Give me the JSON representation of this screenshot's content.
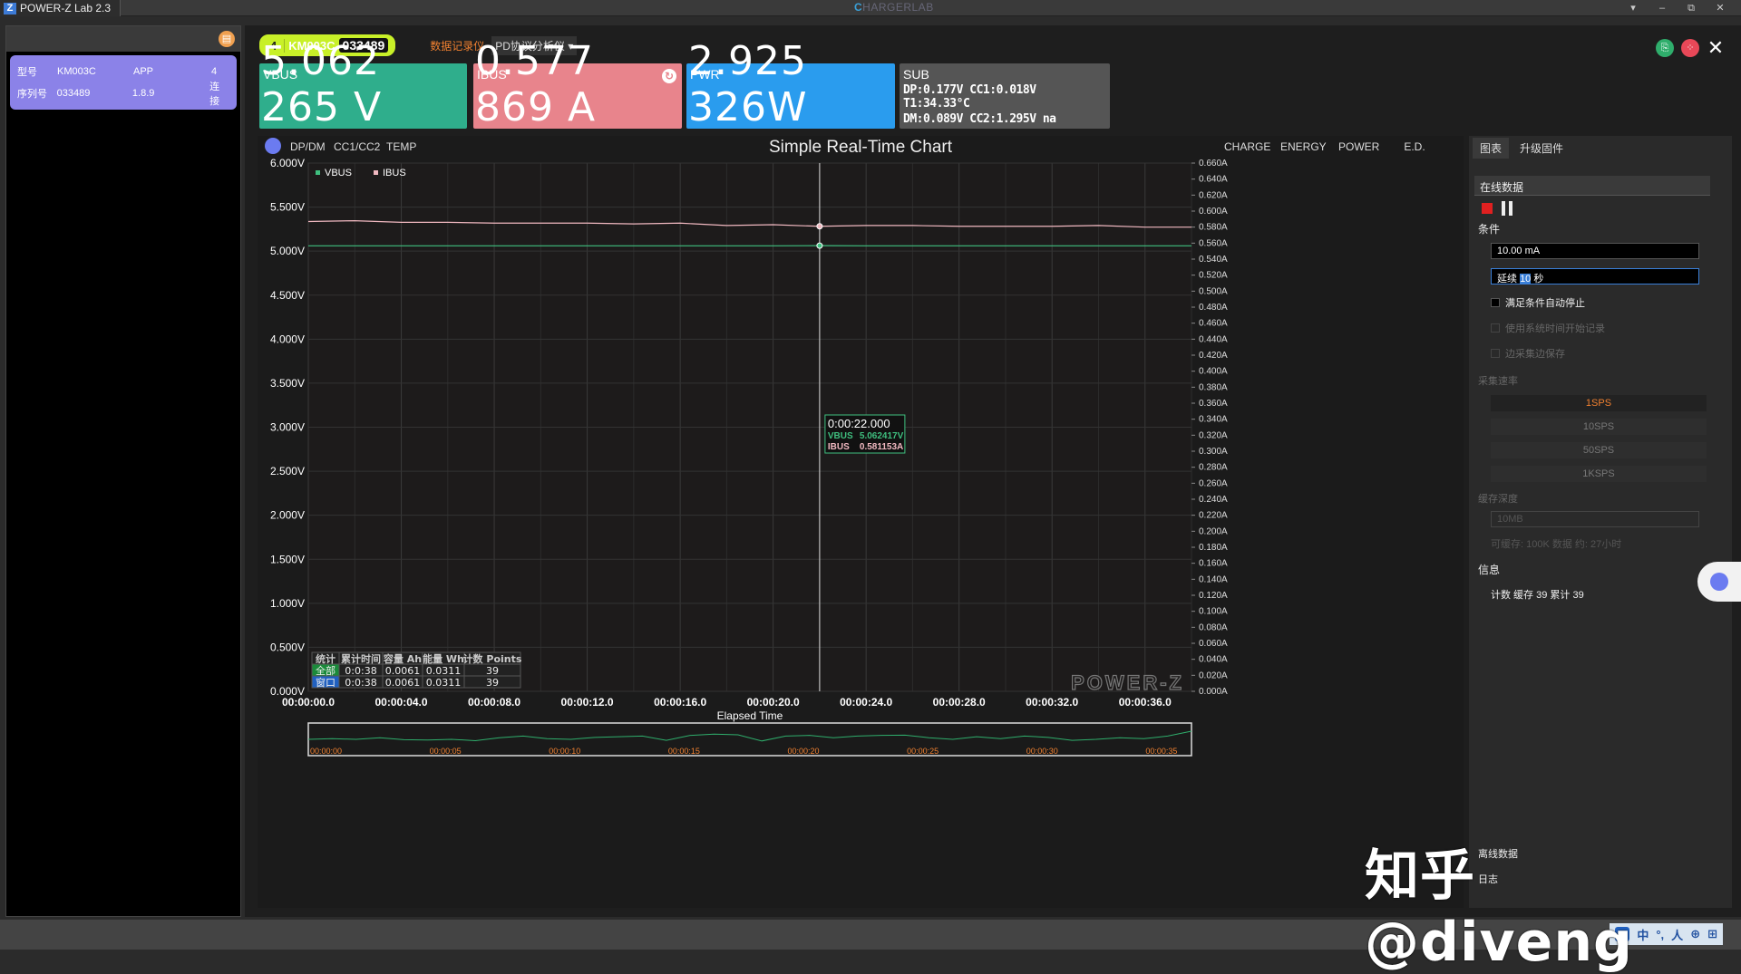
{
  "app": {
    "title": "POWER-Z Lab 2.3",
    "brand_prefix": "C",
    "brand_suffix": "HARGERLAB",
    "logo_glyph": "Z"
  },
  "window_controls": [
    "▾",
    "–",
    "⧉",
    "✕"
  ],
  "left_panel": {
    "device": {
      "row1": {
        "label": "型号",
        "value": "KM003C",
        "key": "APP",
        "num": "4"
      },
      "row2": {
        "label": "序列号",
        "value": "033489",
        "key": "1.8.9",
        "status": "连接"
      }
    }
  },
  "toolbar": {
    "device_num": "4",
    "device_model": "KM003C",
    "device_serial": "033489",
    "recorder_label": "数据记录仪",
    "pd_label": "PD协议分析仪",
    "close_glyph": "✕"
  },
  "tiles": {
    "vbus": {
      "label": "VBUS",
      "value": "5.062 265 V"
    },
    "ibus": {
      "label": "IBUS",
      "value": "0.577 869 A"
    },
    "pwr": {
      "label": "PWR",
      "value": "2.925 326W"
    },
    "sub": {
      "label": "SUB",
      "line1": "DP:0.177V   CC1:0.018V  T1:34.33°C",
      "line2": "DM:0.089V   CC2:1.295V  na"
    }
  },
  "chart_buttons": {
    "left": [
      "DP/DM",
      "CC1/CC2",
      "TEMP"
    ],
    "right": [
      "CHARGE",
      "ENERGY",
      "POWER",
      "E.D."
    ]
  },
  "chart_data": {
    "type": "line",
    "title": "Simple Real-Time Chart",
    "xlabel": "Elapsed Time",
    "ylabel_left": "",
    "ylabel_right": "",
    "x_ticks": [
      "00:00:00.0",
      "00:00:04.0",
      "00:00:08.0",
      "00:00:12.0",
      "00:00:16.0",
      "00:00:20.0",
      "00:00:24.0",
      "00:00:28.0",
      "00:00:32.0",
      "00:00:36.0"
    ],
    "y_left_ticks": [
      "6.000V",
      "5.500V",
      "5.000V",
      "4.500V",
      "4.000V",
      "3.500V",
      "3.000V",
      "2.500V",
      "2.000V",
      "1.500V",
      "1.000V",
      "0.500V",
      "0.000V"
    ],
    "y_right_ticks": [
      "0.660A",
      "0.640A",
      "0.620A",
      "0.600A",
      "0.580A",
      "0.560A",
      "0.540A",
      "0.520A",
      "0.500A",
      "0.480A",
      "0.460A",
      "0.440A",
      "0.420A",
      "0.400A",
      "0.380A",
      "0.360A",
      "0.340A",
      "0.320A",
      "0.300A",
      "0.280A",
      "0.260A",
      "0.240A",
      "0.220A",
      "0.200A",
      "0.180A",
      "0.160A",
      "0.140A",
      "0.120A",
      "0.100A",
      "0.080A",
      "0.060A",
      "0.040A",
      "0.020A",
      "0.000A"
    ],
    "xlim_seconds": [
      0,
      38
    ],
    "ylim_left": [
      0,
      6
    ],
    "ylim_right": [
      0,
      0.66
    ],
    "legend": [
      "VBUS",
      "IBUS"
    ],
    "legend_position": "top-left",
    "grid": true,
    "series": [
      {
        "name": "VBUS",
        "axis": "left",
        "color": "#3fbf7f",
        "x": [
          0,
          2,
          4,
          6,
          8,
          10,
          12,
          14,
          16,
          18,
          20,
          22,
          24,
          26,
          28,
          30,
          32,
          34,
          36,
          38
        ],
        "values": [
          5.06,
          5.06,
          5.06,
          5.06,
          5.06,
          5.06,
          5.06,
          5.06,
          5.06,
          5.06,
          5.06,
          5.062,
          5.06,
          5.06,
          5.06,
          5.06,
          5.06,
          5.06,
          5.06,
          5.06
        ]
      },
      {
        "name": "IBUS",
        "axis": "right",
        "color": "#f0b8c0",
        "x": [
          0,
          2,
          4,
          6,
          8,
          10,
          12,
          14,
          16,
          18,
          20,
          22,
          24,
          26,
          28,
          30,
          32,
          34,
          36,
          38
        ],
        "values": [
          0.587,
          0.588,
          0.586,
          0.586,
          0.585,
          0.585,
          0.585,
          0.584,
          0.585,
          0.582,
          0.583,
          0.581,
          0.582,
          0.582,
          0.581,
          0.581,
          0.581,
          0.582,
          0.58,
          0.58
        ]
      }
    ],
    "cursor": {
      "time": "0:00:22.000",
      "vbus": "5.062417V",
      "ibus": "0.581153A",
      "vbus_label": "VBUS",
      "ibus_label": "IBUS",
      "x_seconds": 22
    }
  },
  "stats": {
    "headers": [
      "统计",
      "累计时间",
      "容量 Ah",
      "能量 Wh",
      "计数 Points"
    ],
    "rows": [
      [
        "全部",
        "0:0:38",
        "0.0061",
        "0.0311",
        "39"
      ],
      [
        "窗口",
        "0:0:38",
        "0.0061",
        "0.0311",
        "39"
      ]
    ]
  },
  "chart_logo": "POWER-Z",
  "overview": {
    "ticks": [
      "00:00:00",
      "00:00:05",
      "00:00:10",
      "00:00:15",
      "00:00:20",
      "00:00:25",
      "00:00:30",
      "00:00:35"
    ],
    "values": [
      0.5,
      0.52,
      0.5,
      0.55,
      0.49,
      0.48,
      0.5,
      0.46,
      0.55,
      0.6,
      0.52,
      0.5,
      0.56,
      0.58,
      0.6,
      0.47,
      0.62,
      0.66,
      0.64,
      0.45,
      0.6,
      0.62,
      0.55,
      0.6,
      0.62,
      0.63,
      0.55,
      0.5,
      0.58,
      0.52,
      0.6,
      0.56,
      0.47,
      0.5,
      0.55,
      0.52,
      0.6,
      0.75
    ]
  },
  "side": {
    "tabs": [
      "图表",
      "升级固件"
    ],
    "online_label": "在线数据",
    "condition_label": "条件",
    "threshold_value": "10.00 mA",
    "duration_prefix": "延续",
    "duration_value": "10",
    "duration_unit": "秒",
    "chk_auto_stop": "满足条件自动停止",
    "chk_system_time": "使用系统时间开始记录",
    "chk_save_while": "边采集边保存",
    "rate_label": "采集速率",
    "rates": [
      "1SPS",
      "10SPS",
      "50SPS",
      "1KSPS"
    ],
    "depth_label": "缓存深度",
    "depth_value": "10MB",
    "depth_note": "可缓存: 100K 数据 约: 27小时",
    "info_label": "信息",
    "info_text": "计数  缓存 39 累计 39",
    "offline_label": "离线数据",
    "log_label": "日志"
  },
  "tray": {
    "items": [
      "中",
      "°,",
      "人",
      "⊕",
      "⊞"
    ]
  },
  "watermark": "知乎 @diveng"
}
